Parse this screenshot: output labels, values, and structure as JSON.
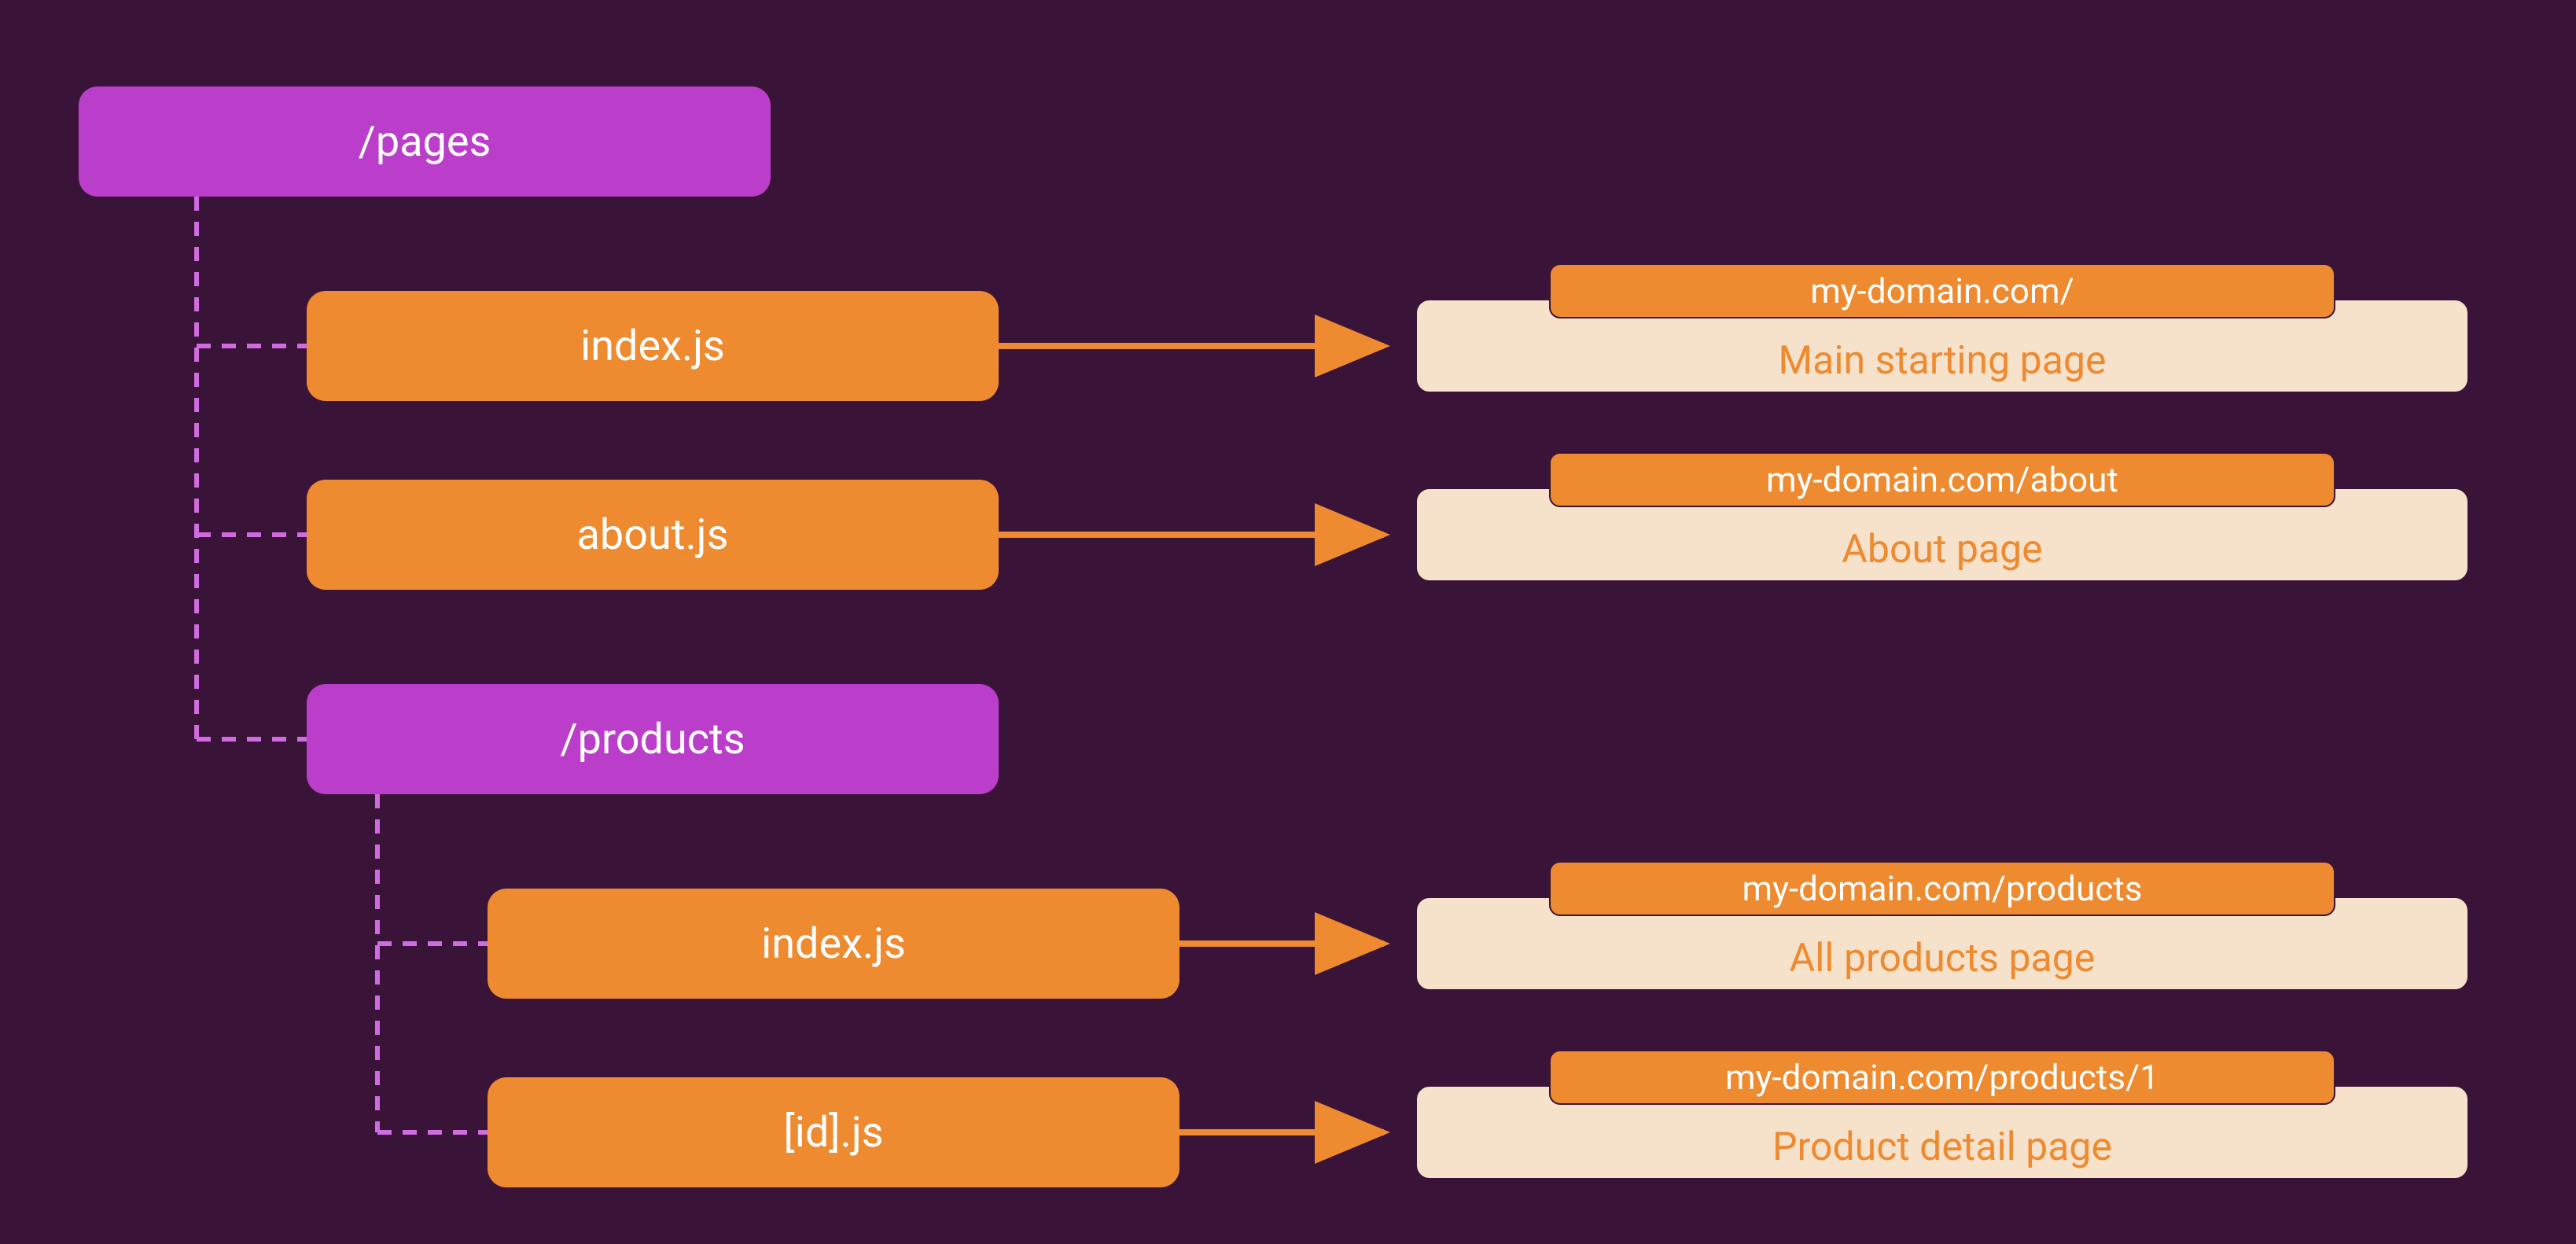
{
  "colors": {
    "bg": "#3a1338",
    "folder": "#bb3ecb",
    "file": "#ee8a2f",
    "card": "#f6e1cb",
    "dash": "#d06be0",
    "arrow": "#ee8a2f"
  },
  "tree": {
    "root": "/pages",
    "children": [
      {
        "file": "index.js",
        "url": "my-domain.com/",
        "desc": "Main starting page"
      },
      {
        "file": "about.js",
        "url": "my-domain.com/about",
        "desc": "About page"
      },
      {
        "folder": "/products",
        "children": [
          {
            "file": "index.js",
            "url": "my-domain.com/products",
            "desc": "All products page"
          },
          {
            "file": "[id].js",
            "url": "my-domain.com/products/1",
            "desc": "Product detail page"
          }
        ]
      }
    ]
  }
}
